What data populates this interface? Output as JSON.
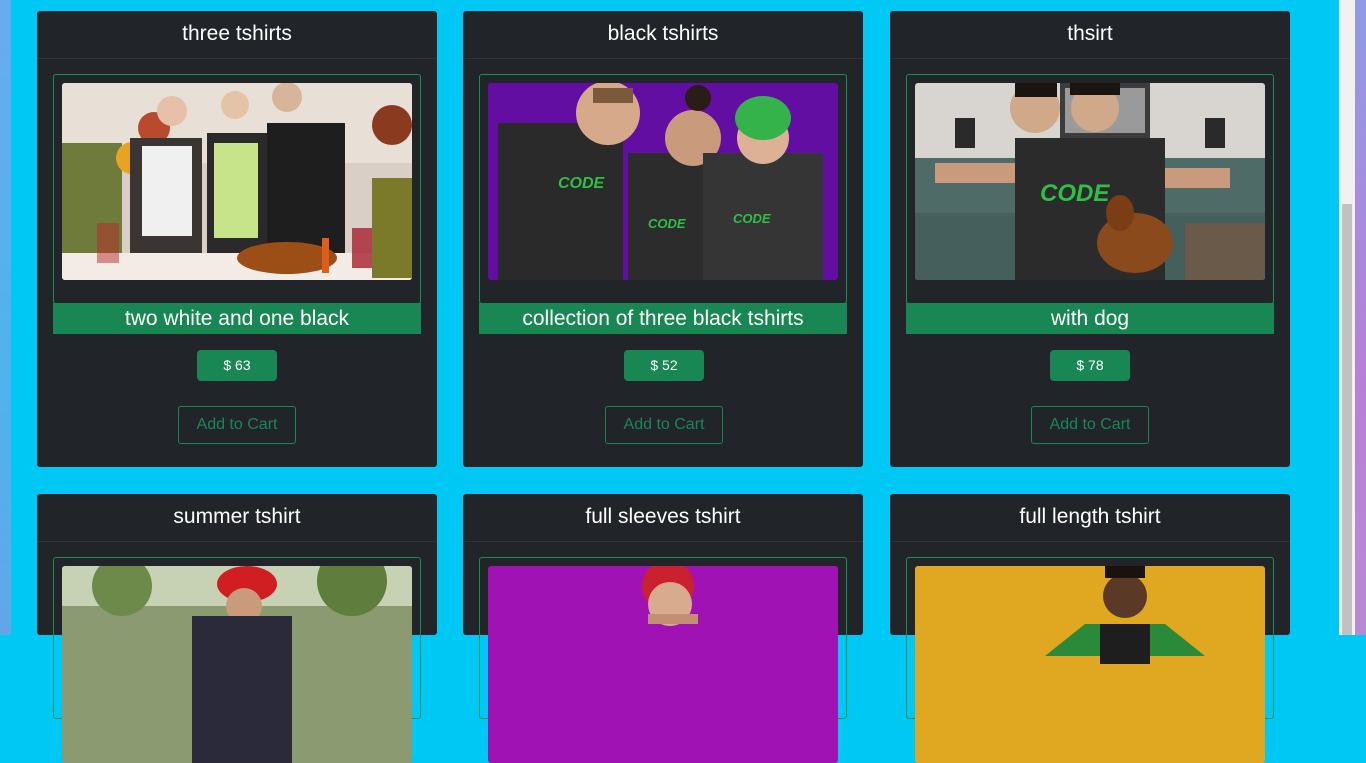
{
  "products": [
    {
      "title": "three tshirts",
      "caption": "two white and one black",
      "price": "$ 63",
      "cart_label": "Add to Cart",
      "image": "three-people-code-tshirts-photo"
    },
    {
      "title": "black tshirts",
      "caption": "collection of three black tshirts",
      "price": "$ 52",
      "cart_label": "Add to Cart",
      "image": "three-friends-black-hoodies-photo"
    },
    {
      "title": "thsirt",
      "caption": "with dog",
      "price": "$ 78",
      "cart_label": "Add to Cart",
      "image": "man-with-dog-photo"
    },
    {
      "title": "summer tshirt",
      "image": "woman-red-hat-photo"
    },
    {
      "title": "full sleeves tshirt",
      "image": "woman-purple-background-photo"
    },
    {
      "title": "full length tshirt",
      "image": "man-yellow-background-photo"
    }
  ],
  "colors": {
    "page_background": "#00c8f5",
    "card_background": "#212529",
    "accent_green": "#198754"
  }
}
